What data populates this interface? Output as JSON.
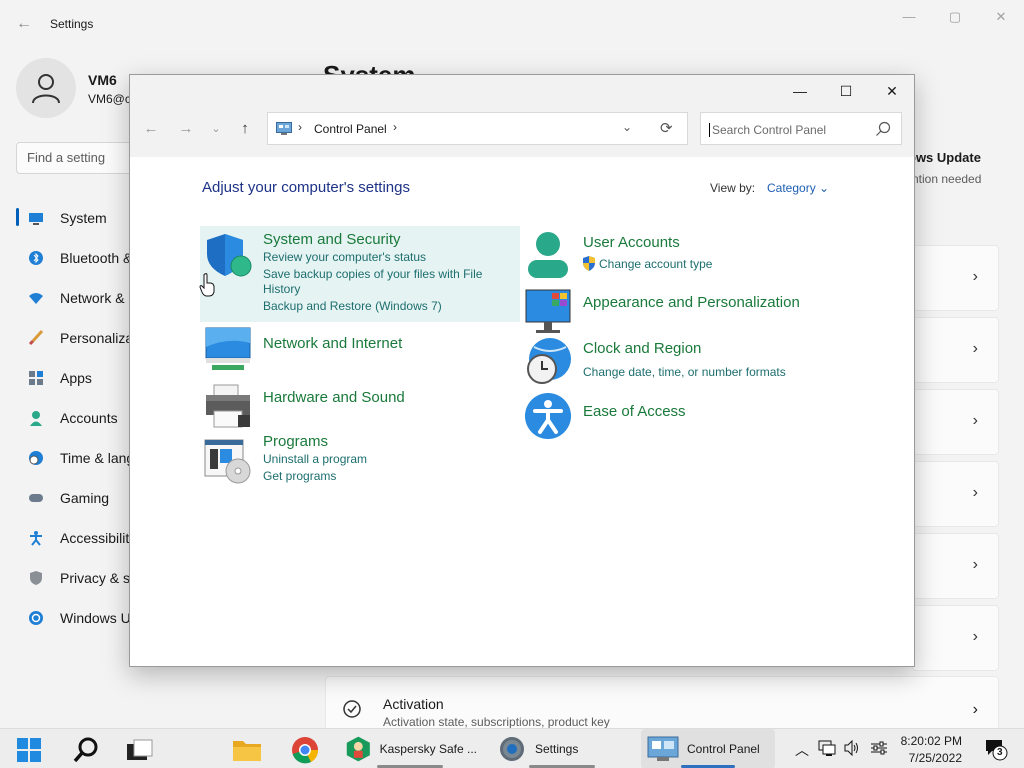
{
  "settings": {
    "title": "Settings",
    "back_label": "←",
    "minimize": "—",
    "maximize": "▢",
    "close": "✕",
    "profile": {
      "name": "VM6",
      "email": "VM6@c"
    },
    "search_placeholder": "Find a setting",
    "nav": [
      {
        "label": "System",
        "icon": "monitor-icon",
        "active": true
      },
      {
        "label": "Bluetooth &",
        "icon": "bluetooth-icon"
      },
      {
        "label": "Network &",
        "icon": "wifi-icon"
      },
      {
        "label": "Personaliza",
        "icon": "brush-icon"
      },
      {
        "label": "Apps",
        "icon": "apps-icon"
      },
      {
        "label": "Accounts",
        "icon": "person-icon"
      },
      {
        "label": "Time & lang",
        "icon": "clock-globe-icon"
      },
      {
        "label": "Gaming",
        "icon": "gamepad-icon"
      },
      {
        "label": "Accessibility",
        "icon": "accessibility-icon"
      },
      {
        "label": "Privacy & se",
        "icon": "shield-icon"
      },
      {
        "label": "Windows U",
        "icon": "update-icon"
      }
    ],
    "main_title": "System",
    "windows_update": {
      "title": "ows Update",
      "subtitle": "ntion needed"
    },
    "card_chevron": "›",
    "activation": {
      "title": "Activation",
      "subtitle": "Activation state, subscriptions, product key"
    }
  },
  "control_panel": {
    "window_buttons": {
      "minimize": "—",
      "maximize": "☐",
      "close": "✕"
    },
    "nav": {
      "back": "←",
      "forward": "→",
      "recent": "⌄",
      "up": "↑"
    },
    "address": {
      "path": "Control Panel",
      "sep": "›"
    },
    "search_placeholder": "Search Control Panel",
    "heading": "Adjust your computer's settings",
    "view_by_label": "View by:",
    "view_by_value": "Category ⌄",
    "categories": [
      {
        "title": "System and Security",
        "icon": "shield-security-icon",
        "links": [
          "Review your computer's status",
          "Save backup copies of your files with File History",
          "Backup and Restore (Windows 7)"
        ]
      },
      {
        "title": "Network and Internet",
        "icon": "network-globe-icon",
        "links": []
      },
      {
        "title": "Hardware and Sound",
        "icon": "printer-icon",
        "links": []
      },
      {
        "title": "Programs",
        "icon": "programs-disc-icon",
        "links": [
          "Uninstall a program",
          "Get programs"
        ]
      },
      {
        "title": "User Accounts",
        "icon": "user-accounts-icon",
        "links": [
          "Change account type"
        ]
      },
      {
        "title": "Appearance and Personalization",
        "icon": "display-colors-icon",
        "links": []
      },
      {
        "title": "Clock and Region",
        "icon": "clock-globe-icon",
        "links": [
          "Change date, time, or number formats"
        ]
      },
      {
        "title": "Ease of Access",
        "icon": "ease-of-access-icon",
        "links": []
      }
    ]
  },
  "taskbar": {
    "apps": [
      {
        "label": "Kaspersky Safe ...",
        "icon": "kaspersky-icon"
      },
      {
        "label": "Settings",
        "icon": "settings-gear-icon"
      },
      {
        "label": "Control Panel",
        "icon": "control-panel-icon"
      }
    ],
    "tray_chevron": "︿",
    "time": "8:20:02 PM",
    "date": "7/25/2022",
    "notification_count": "3"
  }
}
